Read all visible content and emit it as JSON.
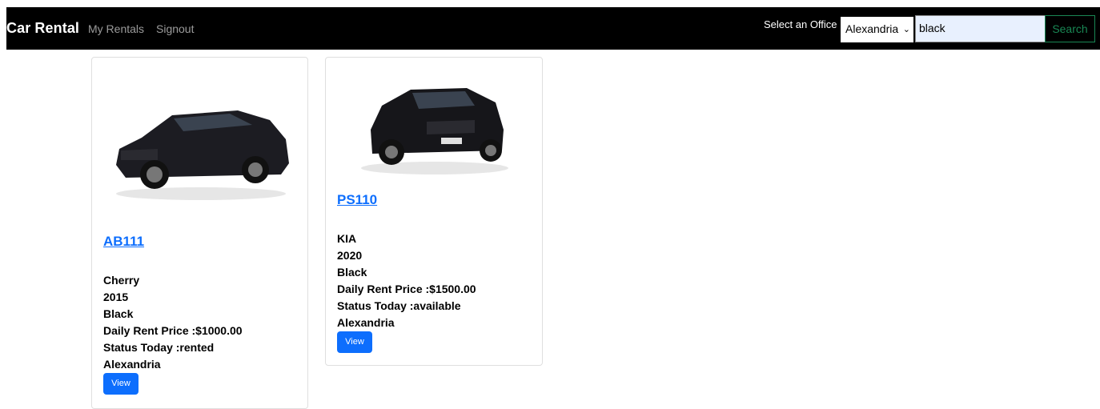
{
  "navbar": {
    "brand": "Car Rental",
    "links": [
      "My Rentals",
      "Signout"
    ],
    "office_label": "Select an Office",
    "office_selected": "Alexandria",
    "search_value": "black",
    "search_button": "Search"
  },
  "colors": {
    "navbar_bg": "#000000",
    "link_blue": "#0d6efd",
    "search_green": "#198754"
  },
  "cars": [
    {
      "plate": "AB111",
      "make": "Cherry",
      "year": "2015",
      "color": "Black",
      "price": "Daily Rent Price :$1000.00",
      "status": "Status Today :rented",
      "office": "Alexandria",
      "view_label": "View"
    },
    {
      "plate": "PS110",
      "make": "KIA",
      "year": "2020",
      "color": "Black",
      "price": "Daily Rent Price :$1500.00",
      "status": "Status Today :available",
      "office": "Alexandria",
      "view_label": "View"
    }
  ]
}
